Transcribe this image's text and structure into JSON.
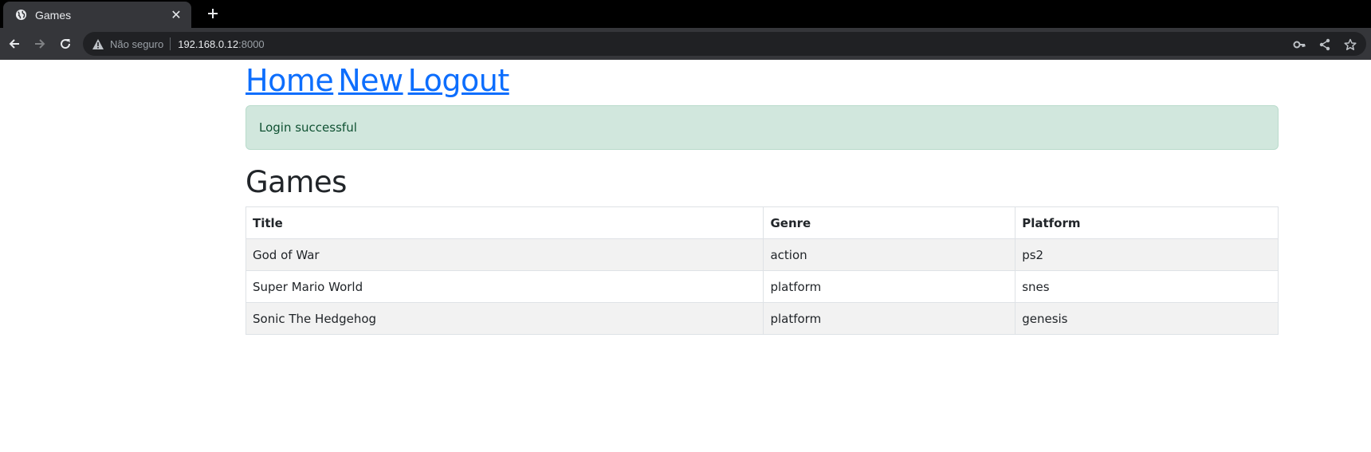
{
  "browser": {
    "tab_title": "Games",
    "tab_close_glyph": "✕",
    "security_label": "Não seguro",
    "url_host": "192.168.0.12",
    "url_port": ":8000"
  },
  "nav": {
    "home": "Home",
    "new": "New",
    "logout": "Logout"
  },
  "alert": {
    "message": "Login successful"
  },
  "page": {
    "heading": "Games"
  },
  "table": {
    "headers": [
      "Title",
      "Genre",
      "Platform"
    ],
    "rows": [
      [
        "God of War",
        "action",
        "ps2"
      ],
      [
        "Super Mario World",
        "platform",
        "snes"
      ],
      [
        "Sonic The Hedgehog",
        "platform",
        "genesis"
      ]
    ]
  },
  "colors": {
    "link": "#0d6efd",
    "alert_bg": "#d1e7dd",
    "alert_text": "#0f5132",
    "striped_row": "#f2f2f2",
    "chrome_toolbar": "#35363a"
  }
}
